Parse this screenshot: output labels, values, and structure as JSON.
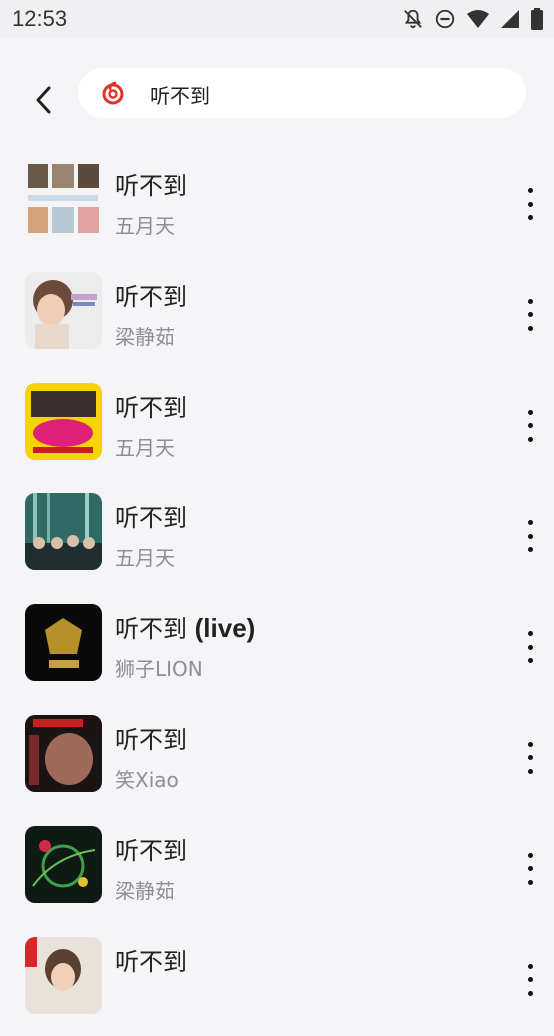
{
  "status": {
    "time": "12:53"
  },
  "search": {
    "query": "听不到"
  },
  "songs": [
    {
      "title": "听不到",
      "title_suffix": "",
      "artist": "五月天"
    },
    {
      "title": "听不到",
      "title_suffix": "",
      "artist": "梁静茹"
    },
    {
      "title": "听不到",
      "title_suffix": "",
      "artist": "五月天"
    },
    {
      "title": "听不到",
      "title_suffix": "",
      "artist": "五月天"
    },
    {
      "title": "听不到",
      "title_suffix": "(live)",
      "artist": "狮子LION"
    },
    {
      "title": "听不到",
      "title_suffix": "",
      "artist": "笑Xiao"
    },
    {
      "title": "听不到",
      "title_suffix": "",
      "artist": "梁静茹"
    },
    {
      "title": "听不到",
      "title_suffix": "",
      "artist": ""
    }
  ],
  "colors": {
    "background": "#f5f5f7",
    "brand_red": "#e0332a",
    "secondary_text": "#8e8e93"
  },
  "icons": {
    "back": "chevron-left-icon",
    "logo": "netease-music-logo-icon",
    "more": "more-vertical-icon"
  }
}
